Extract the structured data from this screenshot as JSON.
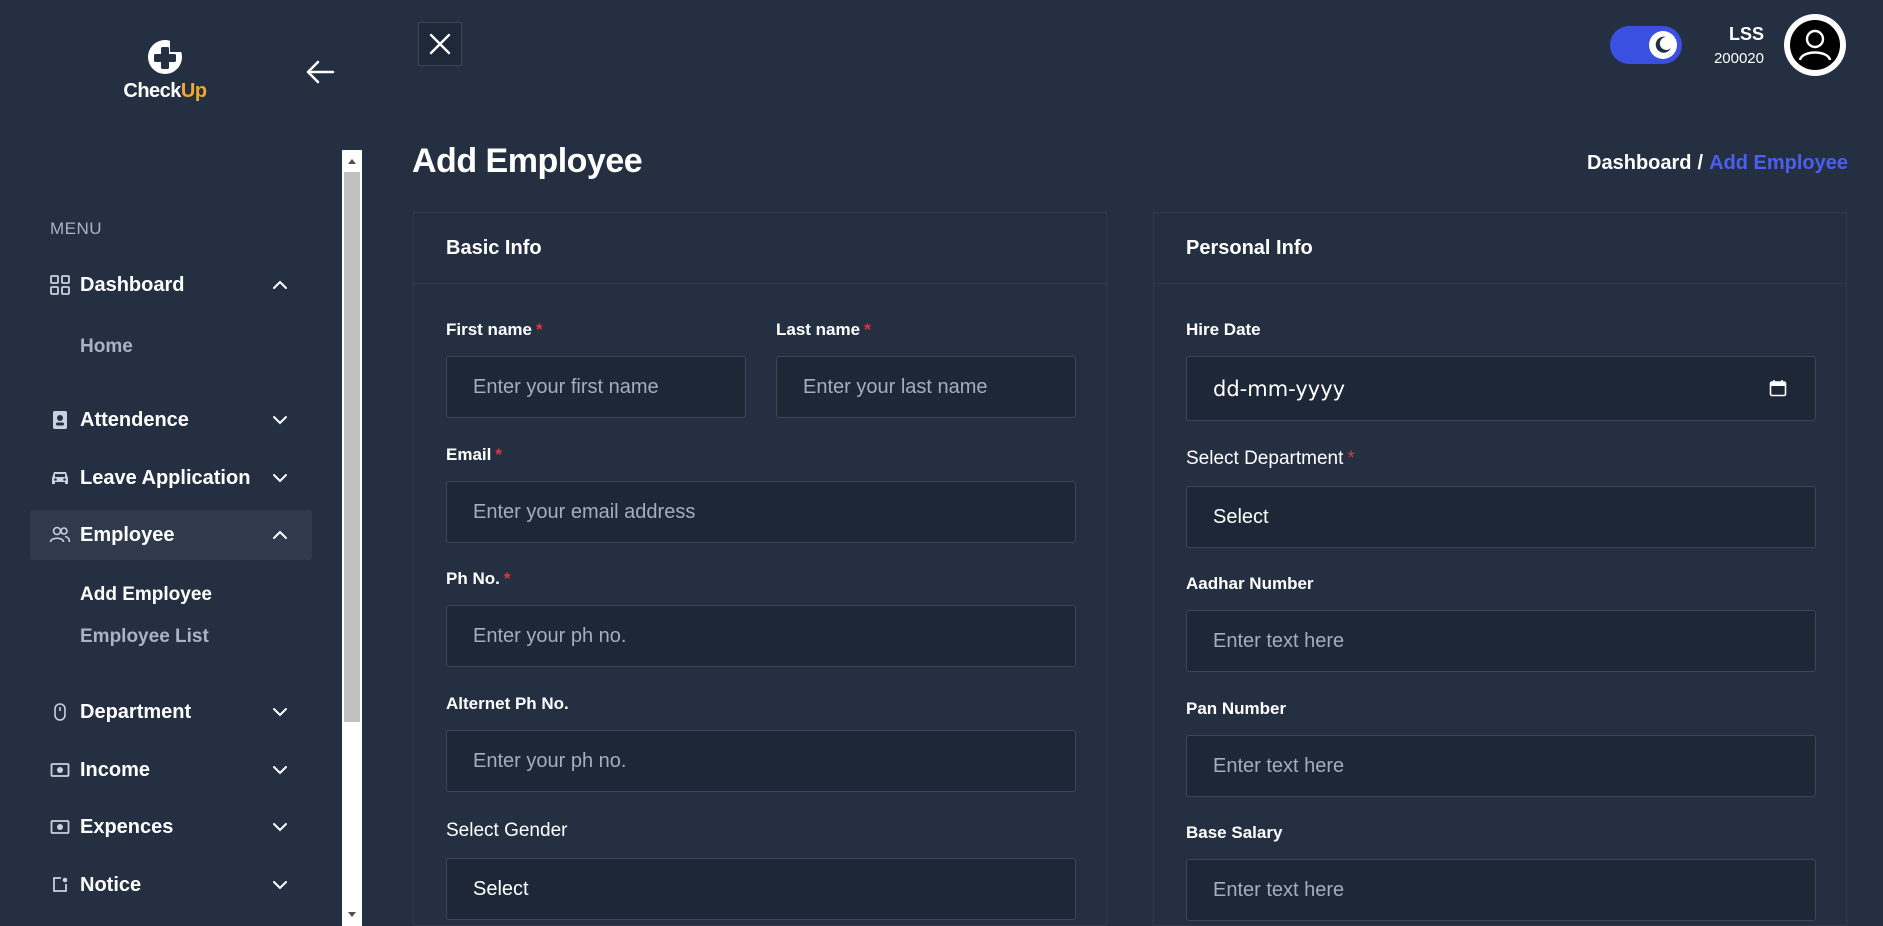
{
  "brand": {
    "name_part1": "Check",
    "name_part2": "Up"
  },
  "sidebar": {
    "menu_label": "MENU",
    "items": [
      {
        "label": "Dashboard",
        "icon": "grid-icon",
        "expanded": true
      },
      {
        "label": "Attendence",
        "icon": "id-card-icon",
        "expanded": false
      },
      {
        "label": "Leave Application",
        "icon": "car-icon",
        "expanded": false
      },
      {
        "label": "Employee",
        "icon": "users-icon",
        "expanded": true,
        "active": true
      },
      {
        "label": "Department",
        "icon": "mouse-icon",
        "expanded": false
      },
      {
        "label": "Income",
        "icon": "money-icon",
        "expanded": false
      },
      {
        "label": "Expences",
        "icon": "money-icon",
        "expanded": false
      },
      {
        "label": "Notice",
        "icon": "notice-icon",
        "expanded": false
      }
    ],
    "dashboard_sub": [
      "Home"
    ],
    "employee_sub": [
      "Add Employee",
      "Employee List"
    ]
  },
  "topbar": {
    "theme": "dark",
    "user_name": "LSS",
    "user_id": "200020"
  },
  "page": {
    "title": "Add Employee",
    "breadcrumb": {
      "home": "Dashboard",
      "separator": "/",
      "current": "Add Employee"
    }
  },
  "basic_info": {
    "title": "Basic Info",
    "first_name": {
      "label": "First name",
      "required": "*",
      "placeholder": "Enter your first name"
    },
    "last_name": {
      "label": "Last name",
      "required": "*",
      "placeholder": "Enter your last name"
    },
    "email": {
      "label": "Email",
      "required": "*",
      "placeholder": "Enter your email address"
    },
    "phone": {
      "label": "Ph No.",
      "required": "*",
      "placeholder": "Enter your ph no."
    },
    "alt_phone": {
      "label": "Alternet Ph No.",
      "placeholder": "Enter your ph no."
    },
    "gender": {
      "label": "Select Gender",
      "value": "Select"
    }
  },
  "personal_info": {
    "title": "Personal Info",
    "hire_date": {
      "label": "Hire Date",
      "value": "dd-mm-yyyy"
    },
    "department": {
      "label": "Select Department",
      "required": "*",
      "value": "Select"
    },
    "aadhar": {
      "label": "Aadhar Number",
      "placeholder": "Enter text here"
    },
    "pan": {
      "label": "Pan Number",
      "placeholder": "Enter text here"
    },
    "salary": {
      "label": "Base Salary",
      "placeholder": "Enter text here"
    }
  },
  "colors": {
    "background": "#243041",
    "input_bg": "#1d2737",
    "accent": "#4a5ef0",
    "required": "#e0343f",
    "brand_up": "#f0a830"
  }
}
